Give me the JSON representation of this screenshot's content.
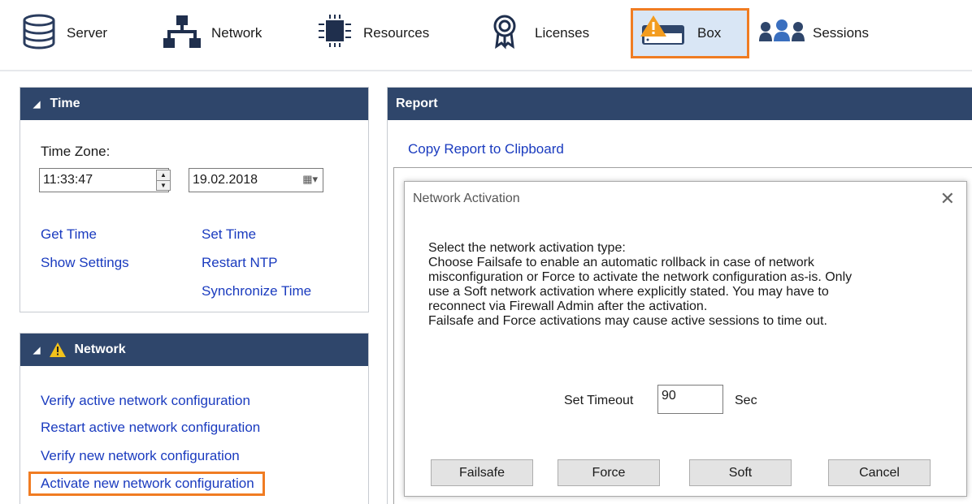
{
  "toolbar": {
    "items": [
      {
        "label": "Server",
        "icon": "database-icon"
      },
      {
        "label": "Network",
        "icon": "network-icon"
      },
      {
        "label": "Resources",
        "icon": "chip-icon"
      },
      {
        "label": "Licenses",
        "icon": "certificate-icon"
      },
      {
        "label": "Box",
        "icon": "box-warning-icon",
        "selected": true
      },
      {
        "label": "Sessions",
        "icon": "users-icon"
      }
    ],
    "accent_color": "#f07c22",
    "selected_bg": "#d9e6f5"
  },
  "time_panel": {
    "title": "Time",
    "timezone_label": "Time Zone:",
    "time_value": "11:33:47",
    "date_value": "19.02.2018",
    "links": {
      "get_time": "Get Time",
      "set_time": "Set Time",
      "show_settings": "Show Settings",
      "restart_ntp": "Restart NTP",
      "synchronize_time": "Synchronize Time"
    }
  },
  "network_panel": {
    "title": "Network",
    "links": [
      "Verify active network configuration",
      "Restart active network configuration",
      "Verify new network configuration",
      "Activate new network configuration"
    ]
  },
  "report_panel": {
    "title": "Report",
    "copy_link": "Copy Report to Clipboard"
  },
  "dialog": {
    "title": "Network Activation",
    "lines": [
      "Select the network activation type:",
      "Choose Failsafe to enable an automatic rollback in case of network",
      "misconfiguration or Force to activate the network configuration as-is. Only",
      "use a Soft network activation where explicitly stated. You may have to",
      "reconnect via Firewall Admin after the activation.",
      "Failsafe and Force activations may cause active sessions to time out."
    ],
    "timeout_label": "Set Timeout",
    "timeout_value": "90",
    "timeout_unit": "Sec",
    "buttons": {
      "failsafe": "Failsafe",
      "force": "Force",
      "soft": "Soft",
      "cancel": "Cancel"
    }
  },
  "colors": {
    "panel_header": "#2f466b",
    "link": "#1a3bbf",
    "highlight": "#f07c22"
  }
}
